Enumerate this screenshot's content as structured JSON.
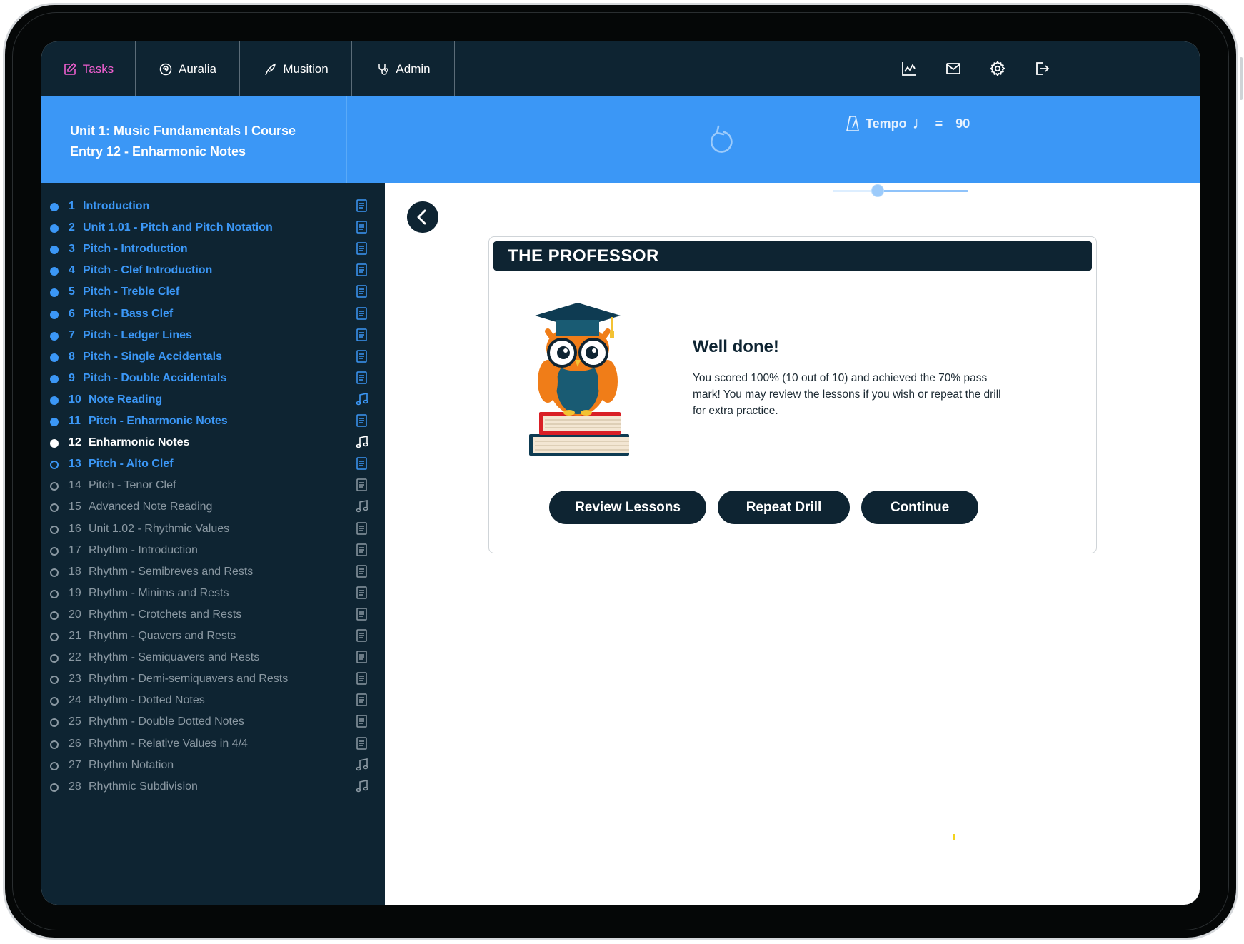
{
  "nav": {
    "tabs": [
      {
        "label": "Tasks",
        "icon": "edit-icon",
        "active": true
      },
      {
        "label": "Auralia",
        "icon": "ear-icon",
        "active": false
      },
      {
        "label": "Musition",
        "icon": "quill-icon",
        "active": false
      },
      {
        "label": "Admin",
        "icon": "stethoscope-icon",
        "active": false
      }
    ],
    "right_icons": [
      "chart-icon",
      "mail-icon",
      "settings-icon",
      "logout-icon"
    ]
  },
  "header": {
    "course_line1": "Unit 1: Music Fundamentals I Course",
    "course_line2": "Entry 12 - Enharmonic Notes",
    "tempo_label": "Tempo",
    "tempo_equals": "=",
    "tempo_value": "90",
    "tempo_slider_fraction": 0.33
  },
  "lessons": [
    {
      "num": "1",
      "title": "Introduction",
      "status": "done",
      "icon": "document-icon"
    },
    {
      "num": "2",
      "title": "Unit 1.01 - Pitch and Pitch Notation",
      "status": "done",
      "icon": "document-icon"
    },
    {
      "num": "3",
      "title": "Pitch - Introduction",
      "status": "done",
      "icon": "document-icon"
    },
    {
      "num": "4",
      "title": "Pitch - Clef Introduction",
      "status": "done",
      "icon": "document-icon"
    },
    {
      "num": "5",
      "title": "Pitch - Treble Clef",
      "status": "done",
      "icon": "document-icon"
    },
    {
      "num": "6",
      "title": "Pitch - Bass Clef",
      "status": "done",
      "icon": "document-icon"
    },
    {
      "num": "7",
      "title": "Pitch - Ledger Lines",
      "status": "done",
      "icon": "document-icon"
    },
    {
      "num": "8",
      "title": "Pitch - Single Accidentals",
      "status": "done",
      "icon": "document-icon"
    },
    {
      "num": "9",
      "title": "Pitch - Double Accidentals",
      "status": "done",
      "icon": "document-icon"
    },
    {
      "num": "10",
      "title": "Note Reading",
      "status": "done",
      "icon": "music-note-icon"
    },
    {
      "num": "11",
      "title": "Pitch - Enharmonic Notes",
      "status": "done",
      "icon": "document-icon"
    },
    {
      "num": "12",
      "title": "Enharmonic Notes",
      "status": "current",
      "icon": "music-note-icon"
    },
    {
      "num": "13",
      "title": "Pitch - Alto Clef",
      "status": "next",
      "icon": "document-icon"
    },
    {
      "num": "14",
      "title": "Pitch - Tenor Clef",
      "status": "locked",
      "icon": "document-icon"
    },
    {
      "num": "15",
      "title": "Advanced Note Reading",
      "status": "locked",
      "icon": "music-note-icon"
    },
    {
      "num": "16",
      "title": "Unit 1.02 - Rhythmic Values",
      "status": "locked",
      "icon": "document-icon"
    },
    {
      "num": "17",
      "title": "Rhythm - Introduction",
      "status": "locked",
      "icon": "document-icon"
    },
    {
      "num": "18",
      "title": "Rhythm - Semibreves and Rests",
      "status": "locked",
      "icon": "document-icon"
    },
    {
      "num": "19",
      "title": "Rhythm - Minims and Rests",
      "status": "locked",
      "icon": "document-icon"
    },
    {
      "num": "20",
      "title": "Rhythm - Crotchets and Rests",
      "status": "locked",
      "icon": "document-icon"
    },
    {
      "num": "21",
      "title": "Rhythm - Quavers and Rests",
      "status": "locked",
      "icon": "document-icon"
    },
    {
      "num": "22",
      "title": "Rhythm - Semiquavers and Rests",
      "status": "locked",
      "icon": "document-icon"
    },
    {
      "num": "23",
      "title": "Rhythm - Demi-semiquavers and Rests",
      "status": "locked",
      "icon": "document-icon"
    },
    {
      "num": "24",
      "title": "Rhythm - Dotted Notes",
      "status": "locked",
      "icon": "document-icon"
    },
    {
      "num": "25",
      "title": "Rhythm - Double Dotted Notes",
      "status": "locked",
      "icon": "document-icon"
    },
    {
      "num": "26",
      "title": "Rhythm - Relative Values in 4/4",
      "status": "locked",
      "icon": "document-icon"
    },
    {
      "num": "27",
      "title": "Rhythm Notation",
      "status": "locked",
      "icon": "music-note-icon"
    },
    {
      "num": "28",
      "title": "Rhythmic Subdivision",
      "status": "locked",
      "icon": "music-note-icon"
    }
  ],
  "result": {
    "heading": "THE PROFESSOR",
    "title": "Well done!",
    "message": "You scored 100% (10 out of 10) and achieved the 70% pass mark! You may review the lessons if you wish or repeat the drill for extra practice.",
    "buttons": {
      "review": "Review Lessons",
      "repeat": "Repeat Drill",
      "continue": "Continue"
    }
  },
  "colors": {
    "navy": "#0e2432",
    "accent_blue": "#3b97f6",
    "active_tab": "#f05fd0",
    "locked_text": "#8a98a2"
  }
}
